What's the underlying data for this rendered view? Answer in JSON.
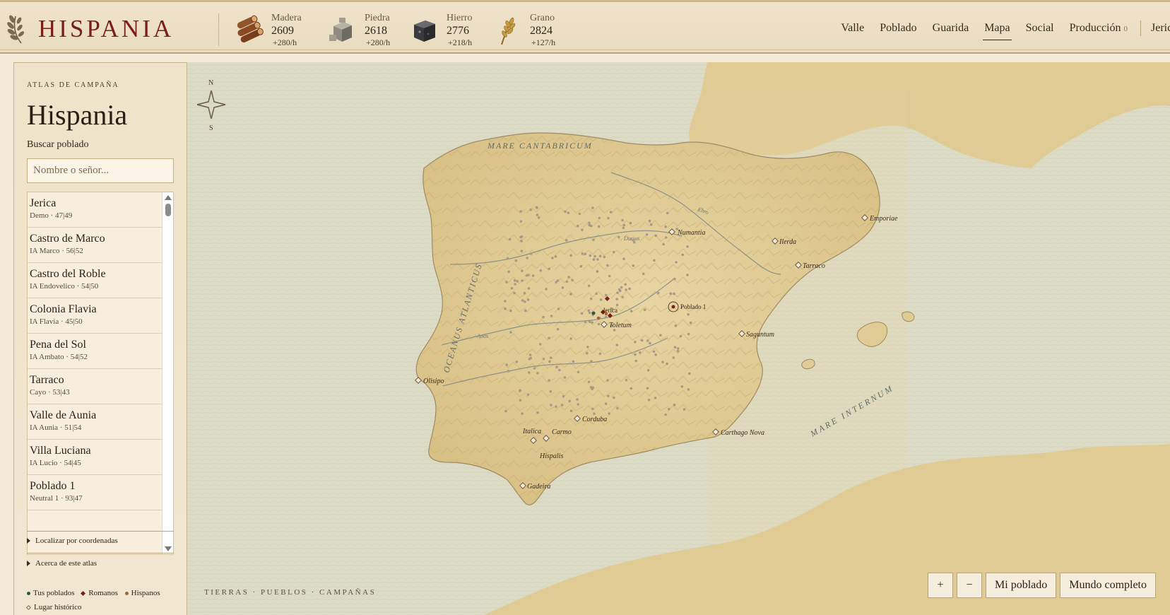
{
  "app": {
    "title": "HISPANIA"
  },
  "resources": [
    {
      "name": "Madera",
      "value": "2609",
      "rate": "+280/h",
      "icon": "wood-logs-icon"
    },
    {
      "name": "Piedra",
      "value": "2618",
      "rate": "+280/h",
      "icon": "stone-block-icon"
    },
    {
      "name": "Hierro",
      "value": "2776",
      "rate": "+218/h",
      "icon": "iron-ingot-icon"
    },
    {
      "name": "Grano",
      "value": "2824",
      "rate": "+127/h",
      "icon": "wheat-icon"
    }
  ],
  "nav": {
    "items": [
      {
        "label": "Valle",
        "active": false
      },
      {
        "label": "Poblado",
        "active": false
      },
      {
        "label": "Guarida",
        "active": false
      },
      {
        "label": "Mapa",
        "active": true
      },
      {
        "label": "Social",
        "active": false
      },
      {
        "label": "Producción",
        "active": false
      }
    ],
    "production_badge": "0",
    "user": "Jerica"
  },
  "sidebar": {
    "kicker": "ATLAS DE CAMPAÑA",
    "title": "Hispania",
    "search_label": "Buscar poblado",
    "search_placeholder": "Nombre o señor...",
    "settlements": [
      {
        "name": "Jerica",
        "sub": "Demo · 47|49"
      },
      {
        "name": "Castro de Marco",
        "sub": "IA Marco · 56|52"
      },
      {
        "name": "Castro del Roble",
        "sub": "IA Endovelico · 54|50"
      },
      {
        "name": "Colonia Flavia",
        "sub": "IA Flavia · 45|50"
      },
      {
        "name": "Pena del Sol",
        "sub": "IA Ambato · 54|52"
      },
      {
        "name": "Tarraco",
        "sub": "Cayo · 53|43"
      },
      {
        "name": "Valle de Aunia",
        "sub": "IA Aunia · 51|54"
      },
      {
        "name": "Villa Luciana",
        "sub": "IA Lucio · 54|45"
      },
      {
        "name": "Poblado 1",
        "sub": "Neutral 1 · 93|47"
      }
    ],
    "legend": {
      "own": "Tus poblados",
      "romans": "Romanos",
      "hispanos": "Hispanos",
      "historic": "Lugar histórico"
    },
    "locate_label": "Localizar por coordenadas",
    "about_label": "Acerca de este atlas"
  },
  "map": {
    "compass_n": "N",
    "compass_s": "S",
    "seas": {
      "cantabricum": "MARE CANTABRICUM",
      "atlanticus": "OCEANUS ATLANTICUS",
      "internum": "MARE INTERNUM"
    },
    "rivers": {
      "ebro": "Ebro",
      "tagus": "Tagus",
      "duero": "Durius",
      "anas": "Anas"
    },
    "places": {
      "numantia": "Numantia",
      "ilerda": "Ilerda",
      "emporiae": "Emporiae",
      "tarraco": "Tarraco",
      "saguntum": "Saguntum",
      "toletum": "Toletum",
      "olisipo": "Olisipo",
      "corduba": "Corduba",
      "italica": "Italica",
      "carmo": "Carmo",
      "hispalis": "Hispalis",
      "gadeira": "Gadeira",
      "carthago": "Carthago Nova"
    },
    "settlement_labels": {
      "jerica": "Jerica",
      "poblado1": "Poblado 1"
    },
    "footer": "TIERRAS · PUEBLOS · CAMPAÑAS",
    "buttons": {
      "zoom_in": "+",
      "zoom_out": "−",
      "my_town": "Mi poblado",
      "whole_world": "Mundo completo"
    }
  },
  "colors": {
    "brand": "#7a1e1a",
    "own": "#2f5a3a",
    "romans": "#7a1e1a",
    "hispanos": "#a0643a",
    "sea": "#dcdcc6",
    "land": "#e3cd97"
  }
}
